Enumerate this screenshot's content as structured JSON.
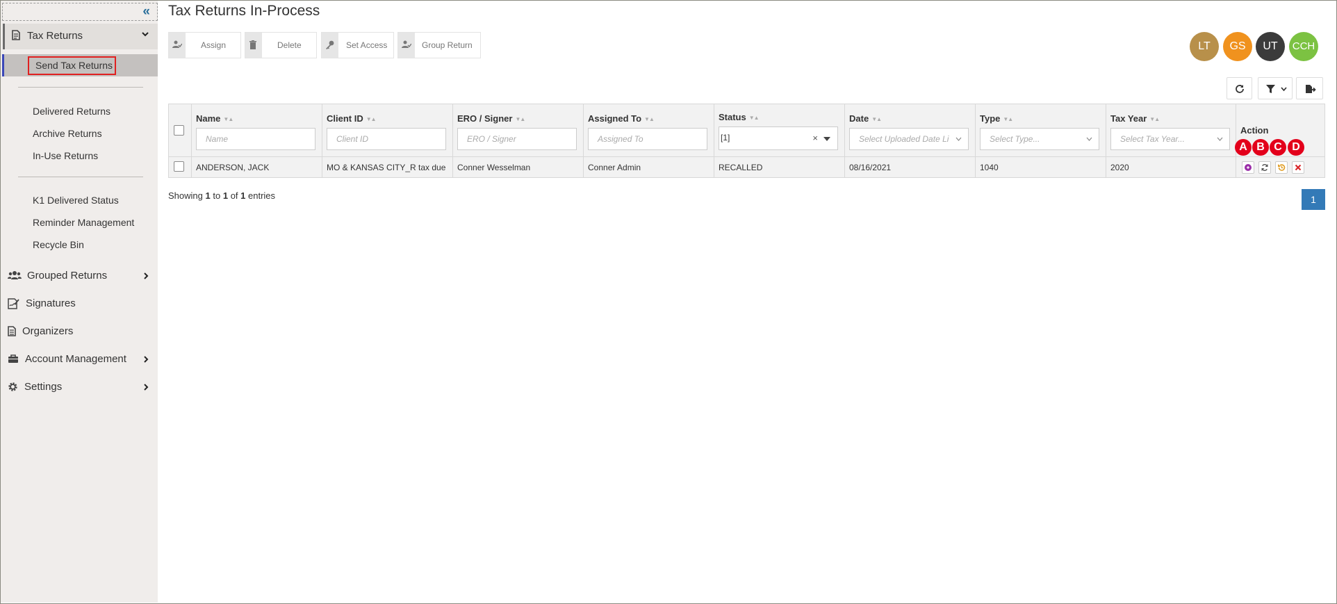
{
  "sidebar": {
    "tax_returns": "Tax Returns",
    "send_tax_returns": "Send Tax Returns",
    "group1": [
      "Delivered Returns",
      "Archive Returns",
      "In-Use Returns"
    ],
    "group2": [
      "K1 Delivered Status",
      "Reminder Management",
      "Recycle Bin"
    ],
    "nav": {
      "grouped_returns": "Grouped Returns",
      "signatures": "Signatures",
      "organizers": "Organizers",
      "account_management": "Account Management",
      "settings": "Settings"
    }
  },
  "page": {
    "title": "Tax Returns In-Process"
  },
  "toolbar": {
    "assign": "Assign",
    "delete": "Delete",
    "set_access": "Set Access",
    "group_return": "Group Return"
  },
  "avatars": [
    {
      "initials": "LT",
      "color": "#b8904a"
    },
    {
      "initials": "GS",
      "color": "#f0921e"
    },
    {
      "initials": "UT",
      "color": "#3b3b3b"
    },
    {
      "initials": "CCH",
      "color": "#7cc242"
    }
  ],
  "table": {
    "headers": [
      "Name",
      "Client ID",
      "ERO / Signer",
      "Assigned To",
      "Status",
      "Date",
      "Type",
      "Tax Year",
      "Action"
    ],
    "placeholders": [
      "Name",
      "Client ID",
      "ERO / Signer",
      "Assigned To",
      "",
      "Select Uploaded Date Li",
      "Select Type...",
      "Select Tax Year..."
    ],
    "status_filter": "[1]",
    "rows": [
      [
        "ANDERSON, JACK",
        "MO & KANSAS CITY_R tax due",
        "Conner Wesselman",
        "Conner Admin",
        "RECALLED",
        "08/16/2021",
        "1040",
        "2020"
      ]
    ]
  },
  "badges": [
    "A",
    "B",
    "C",
    "D"
  ],
  "footer": {
    "showing": "Showing",
    "from": "1",
    "to_word": "to",
    "to": "1",
    "of_word": "of",
    "total": "1",
    "entries": "entries",
    "page": "1"
  },
  "colors": {
    "accent": "#337ab7",
    "badge": "#e3001b",
    "highlight_border": "#e02020"
  }
}
